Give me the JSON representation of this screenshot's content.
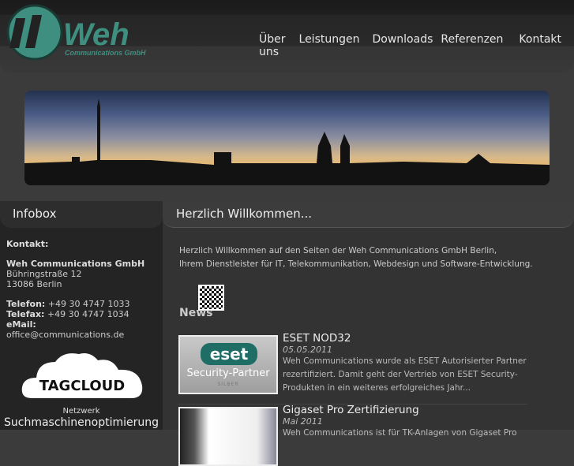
{
  "header": {
    "logo_text": "Weh",
    "logo_sub": "Communications GmbH",
    "nav": [
      "Über uns",
      "Leistungen",
      "Downloads",
      "Referenzen",
      "Kontakt"
    ]
  },
  "sidebar": {
    "title": "Infobox",
    "contact_label": "Kontakt:",
    "company": "Weh Communications GmbH",
    "street": "Bühringstraße 12",
    "city": "13086 Berlin",
    "phone_label": "Telefon:",
    "phone": "+49 30 4747 1033",
    "fax_label": "Telefax:",
    "fax": "+49 30 4747 1034",
    "email_label": "eMail:",
    "email": "office@communications.de",
    "tagcloud": "TAGCLOUD",
    "tag_small": "Netzwerk",
    "tag_large": "Suchmaschinenoptimierung"
  },
  "main": {
    "title": "Herzlich Willkommen...",
    "intro1": "Herzlich Willkommen auf den Seiten der Weh Communications GmbH Berlin,",
    "intro2": "Ihrem Dienstleister für IT, Telekommunikation, Webdesign und Software-Entwicklung.",
    "news_heading": "News",
    "news": [
      {
        "title": "ESET NOD32",
        "date": "05.05.2011",
        "body": "Weh Communications wurde als ESET Autorisierter Partner rezertifiziert. Damit geht der Vertrieb von ESET Security-Produkten in ein weiteres erfolgreiches Jahr...",
        "logo": "eset",
        "logo_sub": "Security-Partner",
        "logo_tier": "SILBER"
      },
      {
        "title": "Gigaset Pro Zertifizierung",
        "date": "Mai 2011",
        "body": "Weh Communications ist für TK-Anlagen von Gigaset Pro"
      }
    ]
  }
}
